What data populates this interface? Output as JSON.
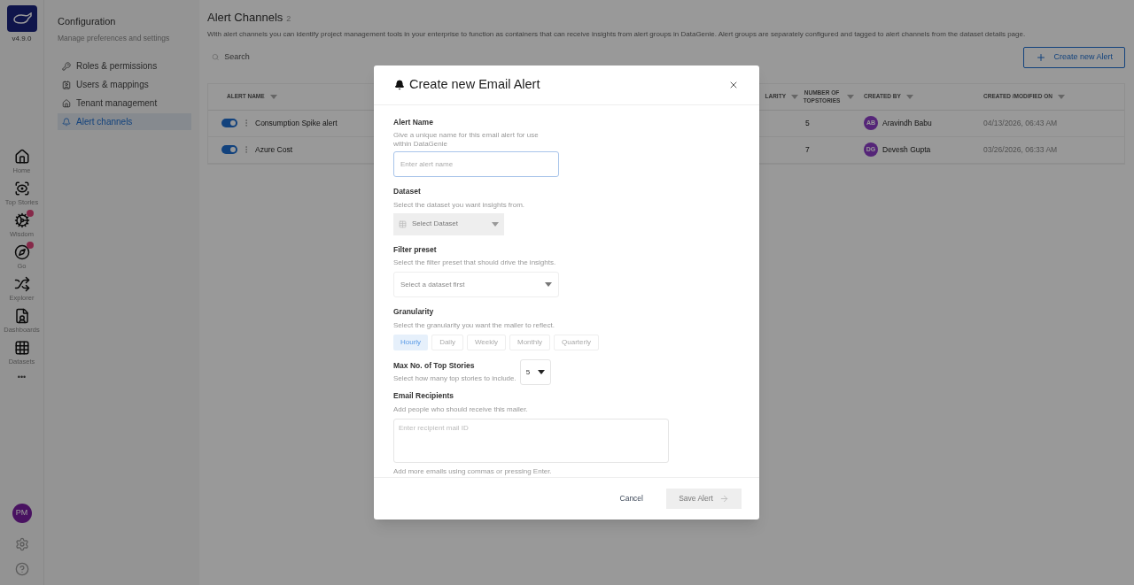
{
  "app": {
    "version": "v4.9.0"
  },
  "nav": {
    "items": [
      {
        "label": "Home",
        "badge": false
      },
      {
        "label": "Top Stories",
        "badge": false
      },
      {
        "label": "Wisdom",
        "badge": true
      },
      {
        "label": "Go",
        "badge": true
      },
      {
        "label": "Explorer",
        "badge": false
      },
      {
        "label": "Dashboards",
        "badge": false
      },
      {
        "label": "Datasets",
        "badge": false
      }
    ],
    "more": "•••",
    "user_initials": "PM"
  },
  "settings": {
    "title": "Configuration",
    "subtitle": "Manage preferences and settings",
    "items": [
      {
        "label": "Roles & permissions",
        "selected": false
      },
      {
        "label": "Users & mappings",
        "selected": false
      },
      {
        "label": "Tenant management",
        "selected": false
      },
      {
        "label": "Alert channels",
        "selected": true
      }
    ]
  },
  "page": {
    "title": "Alert Channels",
    "count": "2",
    "description": "With alert channels you can identify project management tools in your enterprise to function as containers that can receive insights from alert groups in DataGenie. Alert groups are separately configured and tagged to alert channels from the dataset details page.",
    "search_placeholder": "Search",
    "create_button": "Create new Alert"
  },
  "table": {
    "columns": [
      "ALERT NAME",
      "LARITY",
      "NUMBER OF TOPSTORIES",
      "CREATED BY",
      "CREATED /MODIFIED ON"
    ],
    "rows": [
      {
        "enabled": true,
        "name": "Consumption Spike alert",
        "topstories": "5",
        "creator_initials": "AB",
        "creator": "Aravindh Babu",
        "created": "04/13/2026, 06:43 AM"
      },
      {
        "enabled": true,
        "name": "Azure Cost",
        "topstories": "7",
        "creator_initials": "DG",
        "creator": "Devesh Gupta",
        "created": "03/26/2026, 06:33 AM"
      }
    ]
  },
  "modal": {
    "title": "Create new Email Alert",
    "alert_name": {
      "label": "Alert Name",
      "help": "Give a unique name for this email alert for use within DataGenie",
      "placeholder": "Enter alert name"
    },
    "dataset": {
      "label": "Dataset",
      "help": "Select the dataset you want insights from.",
      "placeholder": "Select Dataset"
    },
    "filter": {
      "label": "Filter preset",
      "help": "Select the filter preset that should drive the insights.",
      "placeholder": "Select a dataset first"
    },
    "granularity": {
      "label": "Granularity",
      "help": "Select the granularity you want the mailer to reflect.",
      "options": [
        {
          "label": "Hourly",
          "selected": true
        },
        {
          "label": "Daily",
          "selected": false
        },
        {
          "label": "Weekly",
          "selected": false
        },
        {
          "label": "Monthly",
          "selected": false
        },
        {
          "label": "Quarterly",
          "selected": false
        }
      ]
    },
    "max_stories": {
      "label": "Max No. of Top Stories",
      "help": "Select how many top stories to include.",
      "value": "5"
    },
    "recipients": {
      "label": "Email Recipients",
      "help": "Add people who should receive this mailer.",
      "placeholder": "Enter recipient mail ID",
      "note": "Add more emails using commas or pressing Enter."
    },
    "cancel": "Cancel",
    "save": "Save Alert"
  }
}
